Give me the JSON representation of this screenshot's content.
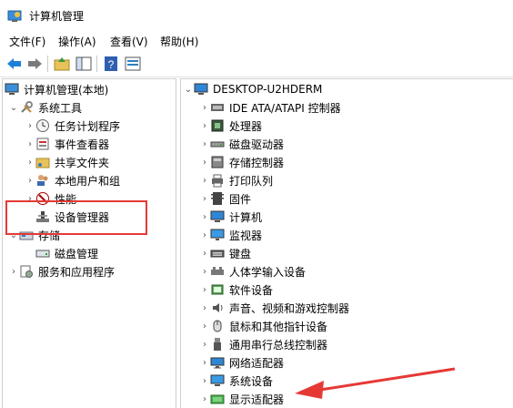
{
  "window": {
    "title": "计算机管理"
  },
  "menu": [
    "文件(F)",
    "操作(A)",
    "查看(V)",
    "帮助(H)"
  ],
  "left_tree": {
    "root": "计算机管理(本地)",
    "system_tools": "系统工具",
    "task_scheduler": "任务计划程序",
    "event_viewer": "事件查看器",
    "shared_folders": "共享文件夹",
    "local_users": "本地用户和组",
    "performance": "性能",
    "device_manager": "设备管理器",
    "storage": "存储",
    "disk_management": "磁盘管理",
    "services": "服务和应用程序"
  },
  "right_tree": {
    "computer_name": "DESKTOP-U2HDERM",
    "items": [
      "IDE ATA/ATAPI 控制器",
      "处理器",
      "磁盘驱动器",
      "存储控制器",
      "打印队列",
      "固件",
      "计算机",
      "监视器",
      "键盘",
      "人体学输入设备",
      "软件设备",
      "声音、视频和游戏控制器",
      "鼠标和其他指针设备",
      "通用串行总线控制器",
      "网络适配器",
      "系统设备",
      "显示适配器"
    ],
    "icons": [
      "ide-controller-icon",
      "processor-icon",
      "disk-drive-icon",
      "storage-controller-icon",
      "print-queue-icon",
      "firmware-icon",
      "computer-icon",
      "monitor-icon",
      "keyboard-icon",
      "hid-icon",
      "software-device-icon",
      "sound-icon",
      "mouse-icon",
      "usb-icon",
      "network-adapter-icon",
      "system-device-icon",
      "display-adapter-icon"
    ]
  },
  "colors": {
    "highlight": "#e53935",
    "accent": "#1e7fd6"
  }
}
